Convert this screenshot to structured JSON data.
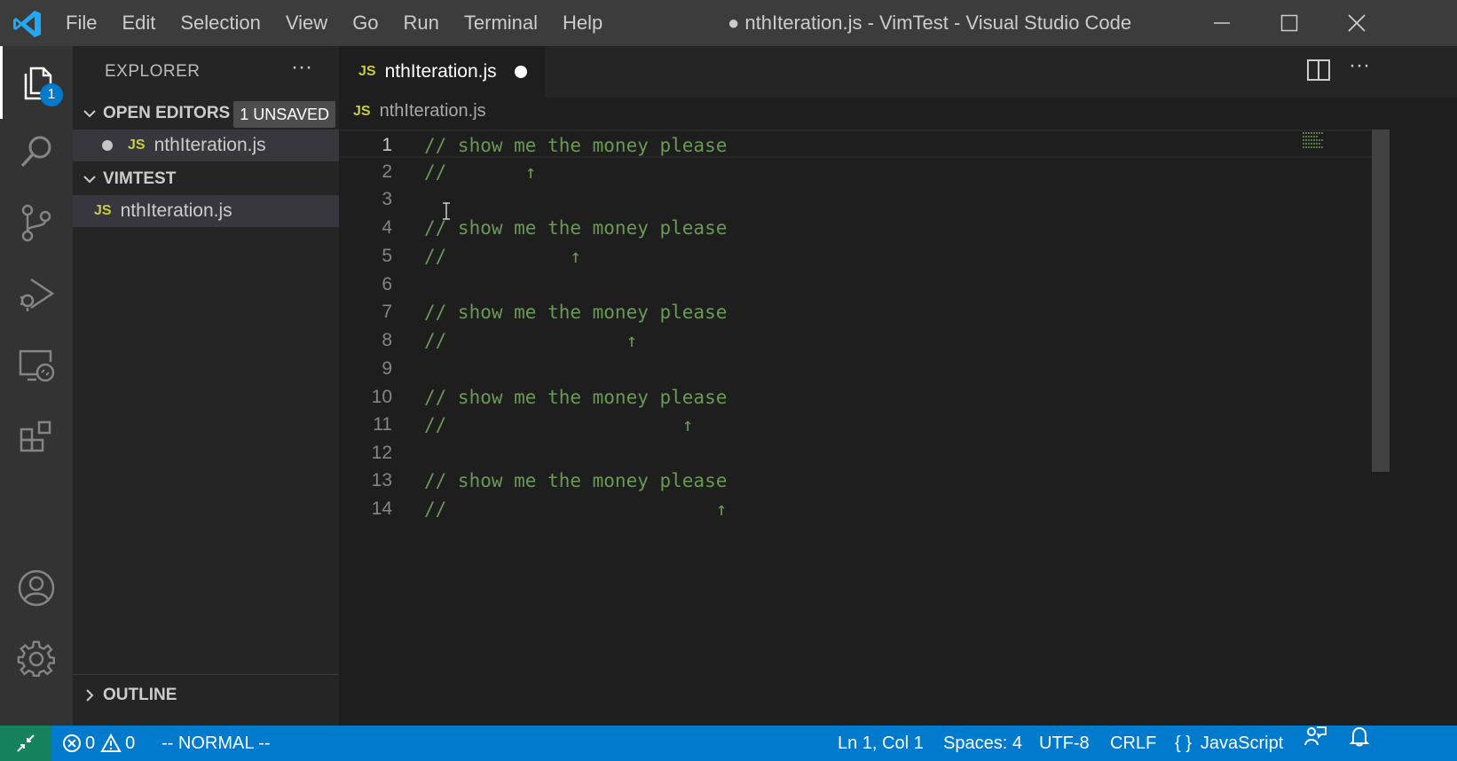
{
  "titlebar": {
    "menu": [
      "File",
      "Edit",
      "Selection",
      "View",
      "Go",
      "Run",
      "Terminal",
      "Help"
    ],
    "window_title": "● nthIteration.js - VimTest - Visual Studio Code"
  },
  "activitybar": {
    "explorer_badge": "1"
  },
  "sidebar": {
    "title": "EXPLORER",
    "more_label": "···",
    "open_editors": {
      "label": "OPEN EDITORS",
      "badge": "1 UNSAVED",
      "file": "nthIteration.js",
      "file_type": "JS"
    },
    "workspace": {
      "label": "VIMTEST",
      "file": "nthIteration.js",
      "file_type": "JS"
    },
    "outline_label": "OUTLINE"
  },
  "editor": {
    "tab": {
      "file_type": "JS",
      "label": "nthIteration.js"
    },
    "breadcrumb": {
      "file_type": "JS",
      "label": "nthIteration.js"
    },
    "more_label": "···",
    "lines": [
      {
        "n": "1",
        "text": "// show me the money please"
      },
      {
        "n": "2",
        "text": "//       ↑"
      },
      {
        "n": "3",
        "text": ""
      },
      {
        "n": "4",
        "text": "// show me the money please"
      },
      {
        "n": "5",
        "text": "//           ↑"
      },
      {
        "n": "6",
        "text": ""
      },
      {
        "n": "7",
        "text": "// show me the money please"
      },
      {
        "n": "8",
        "text": "//                ↑"
      },
      {
        "n": "9",
        "text": ""
      },
      {
        "n": "10",
        "text": "// show me the money please"
      },
      {
        "n": "11",
        "text": "//                     ↑"
      },
      {
        "n": "12",
        "text": ""
      },
      {
        "n": "13",
        "text": "// show me the money please"
      },
      {
        "n": "14",
        "text": "//                        ↑"
      }
    ]
  },
  "statusbar": {
    "errors": "0",
    "warnings": "0",
    "vim_mode": "-- NORMAL --",
    "position": "Ln 1, Col 1",
    "indent": "Spaces: 4",
    "encoding": "UTF-8",
    "eol": "CRLF",
    "language_icon": "{ }",
    "language": "JavaScript"
  },
  "colors": {
    "accent": "#007acc",
    "remote": "#16825d",
    "comment": "#6a9955",
    "js_badge": "#cbcb41"
  }
}
